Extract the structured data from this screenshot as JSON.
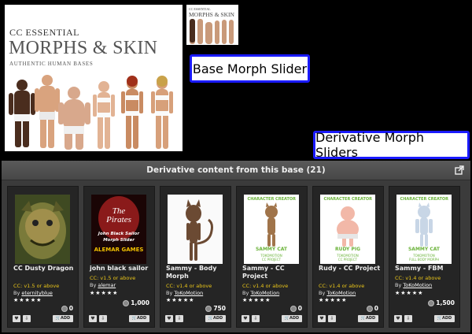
{
  "cover": {
    "line1": "CC ESSENTIAL",
    "line2": "MORPHS & SKIN",
    "line3": "AUTHENTIC HUMAN BASES"
  },
  "thumb": {
    "line1": "CC ESSENTIAL",
    "line2": "MORPHS & SKIN"
  },
  "callouts": {
    "base": "Base Morph Slider",
    "derivative": "Derivative Morph Sliders"
  },
  "panel": {
    "title": "Derivative content from this base (21)"
  },
  "cards": [
    {
      "title": "CC Dusty Dragon",
      "compat": "CC: v1.5 or above",
      "by": "By",
      "author": "eternityblue",
      "stars": "★★★★★",
      "price": "0",
      "add": "ADD"
    },
    {
      "title": "john black sailor",
      "compat": "CC: v1.5 or above",
      "by": "By",
      "author": "alemar",
      "stars": "★★★★★",
      "price": "1,000",
      "add": "ADD",
      "art": {
        "l1": "The",
        "l2": "Pirates",
        "l3": "John Black Sailor",
        "l4": "Morph Slider",
        "l5": "ALEMAR GAMES"
      }
    },
    {
      "title": "Sammy - Body Morph",
      "compat": "CC: v1.4 or above",
      "by": "By",
      "author": "ToKoMotion",
      "stars": "★★★★★",
      "price": "750",
      "add": "ADD"
    },
    {
      "title": "Sammy - CC Project",
      "compat": "CC: v1.4 or above",
      "by": "By",
      "author": "ToKoMotion",
      "stars": "★★★★★",
      "price": "0",
      "add": "ADD",
      "art": {
        "brand": "CHARACTER CREATOR",
        "name": "SAMMY CAT",
        "sub1": "TOKOMOTION",
        "sub2": "CC PROJECT"
      }
    },
    {
      "title": "Rudy - CC Project",
      "compat": "CC: v1.4 or above",
      "by": "By",
      "author": "ToKoMotion",
      "stars": "★★★★★",
      "price": "0",
      "add": "ADD",
      "art": {
        "brand": "CHARACTER CREATOR",
        "name": "RUDY PIG",
        "sub1": "TOKOMOTION",
        "sub2": "CC PROJECT"
      }
    },
    {
      "title": "Sammy - FBM",
      "compat": "CC: v1.4 or above",
      "by": "By",
      "author": "ToKoMotion",
      "stars": "★★★★★",
      "price": "1,500",
      "add": "ADD",
      "art": {
        "brand": "CHARACTER CREATOR",
        "name": "SAMMY CAT",
        "sub1": "TOKOMOTION",
        "sub2": "FULL BODY MORPH"
      }
    }
  ]
}
